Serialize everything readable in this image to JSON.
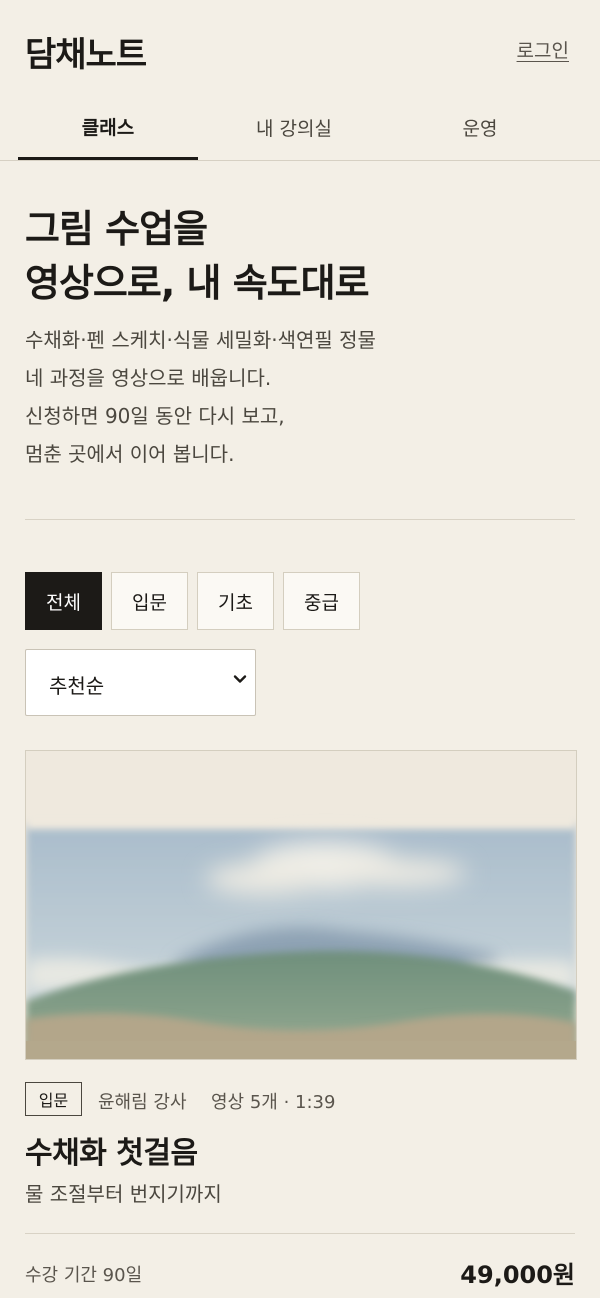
{
  "header": {
    "logo": "담채노트",
    "login_label": "로그인"
  },
  "tabs": [
    {
      "label": "클래스",
      "active": true
    },
    {
      "label": "내 강의실",
      "active": false
    },
    {
      "label": "운영",
      "active": false
    }
  ],
  "hero": {
    "title_lines": [
      "그림 수업을",
      "영상으로, 내 속도대로"
    ],
    "desc_lines": [
      "수채화·펜 스케치·식물 세밀화·색연필 정물",
      "네 과정을 영상으로 배웁니다.",
      "신청하면 90일 동안 다시 보고,",
      "멈춘 곳에서 이어 봅니다."
    ]
  },
  "filters": [
    {
      "label": "전체",
      "active": true
    },
    {
      "label": "입문",
      "active": false
    },
    {
      "label": "기초",
      "active": false
    },
    {
      "label": "중급",
      "active": false
    }
  ],
  "sort": {
    "selected": "추천순",
    "icon": "chevron-down-icon"
  },
  "course": {
    "level": "입문",
    "instructor": "윤해림 강사",
    "videos": "영상 5개 · 1:39",
    "title": "수채화 첫걸음",
    "subtitle": "물 조절부터 번지기까지",
    "period": "수강 기간 90일",
    "price": "49,000원"
  },
  "colors": {
    "background": "#f3efe6",
    "text": "#1c1a17",
    "accent": "#1c1a17"
  }
}
